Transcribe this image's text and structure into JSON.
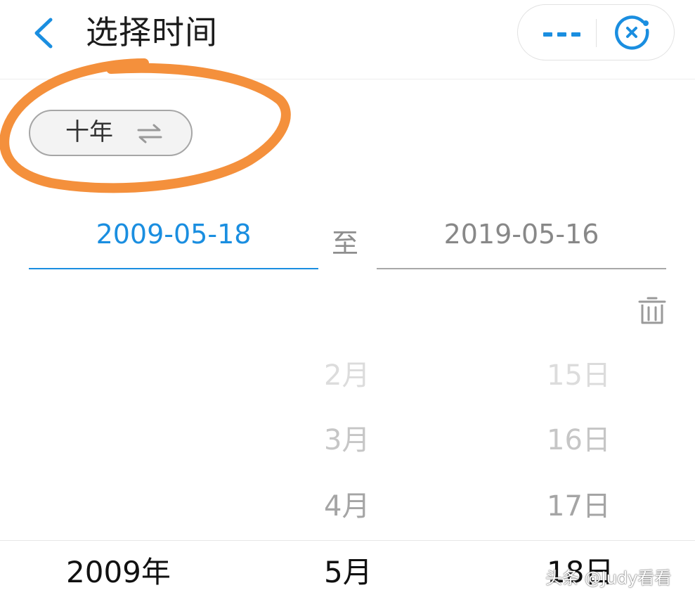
{
  "header": {
    "title": "选择时间",
    "back_icon": "chevron-left-icon",
    "more_icon": "more-dots-icon",
    "close_icon": "close-circle-icon",
    "accent_color": "#1a8ee0"
  },
  "range_toggle": {
    "label": "十年",
    "icon": "⇌"
  },
  "annotation": {
    "color": "#f4903c"
  },
  "date_range": {
    "start": "2009-05-18",
    "separator": "至",
    "end": "2019-05-16",
    "clear_icon": "trash-icon"
  },
  "picker": {
    "year": {
      "selected": "2009年"
    },
    "month": {
      "above": [
        "2月",
        "3月",
        "4月"
      ],
      "selected": "5月"
    },
    "day": {
      "above": [
        "15日",
        "16日",
        "17日"
      ],
      "selected": "18日"
    }
  },
  "watermark": "头条 @Judy看看"
}
